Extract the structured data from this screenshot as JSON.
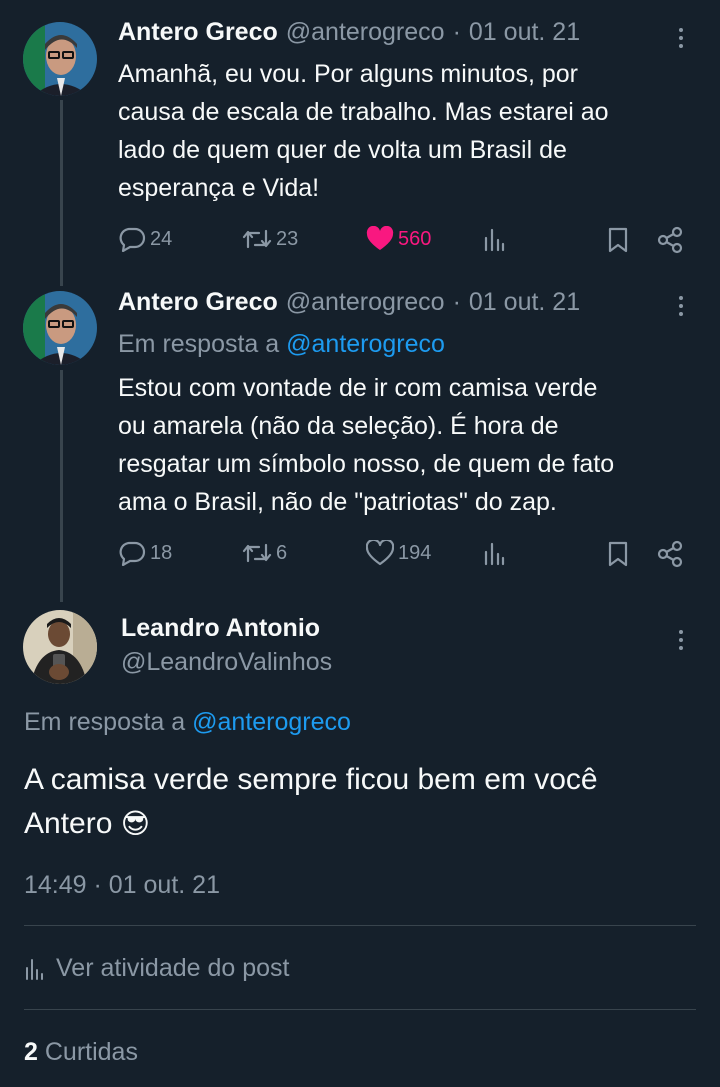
{
  "tweets": [
    {
      "name": "Antero Greco",
      "handle": "@anterogreco",
      "separator": "·",
      "date": "01 out. 21",
      "lines": [
        "Amanhã, eu vou. Por alguns minutos, por",
        "causa de escala de trabalho.  Mas estarei ao",
        "lado de quem quer de volta um Brasil de",
        "esperança e Vida!"
      ],
      "replies": "24",
      "retweets": "23",
      "likes": "560",
      "liked": true
    },
    {
      "name": "Antero Greco",
      "handle": "@anterogreco",
      "separator": "·",
      "date": "01 out. 21",
      "reply_prefix": "Em resposta a",
      "reply_to": "@anterogreco",
      "lines": [
        "Estou com vontade de ir com camisa verde",
        "ou amarela (não da seleção). É hora de",
        "resgatar um símbolo nosso, de quem de fato",
        "ama o Brasil, não de \"patriotas\" do zap."
      ],
      "replies": "18",
      "retweets": "6",
      "likes": "194",
      "liked": false
    }
  ],
  "main": {
    "name": "Leandro Antonio",
    "handle": "@LeandroValinhos",
    "reply_prefix": "Em resposta a",
    "reply_to": "@anterogreco",
    "line1": "A camisa verde sempre ficou bem em você",
    "line2": "Antero",
    "emoji": "😎",
    "timestamp": "14:49 · 01 out. 21",
    "activity_label": "Ver atividade do post",
    "likes_count": "2",
    "likes_label": "Curtidas"
  },
  "colors": {
    "background": "#15202b",
    "text": "#f7f9f9",
    "muted": "#8b98a5",
    "link": "#1d9bf0",
    "like": "#f91880"
  }
}
